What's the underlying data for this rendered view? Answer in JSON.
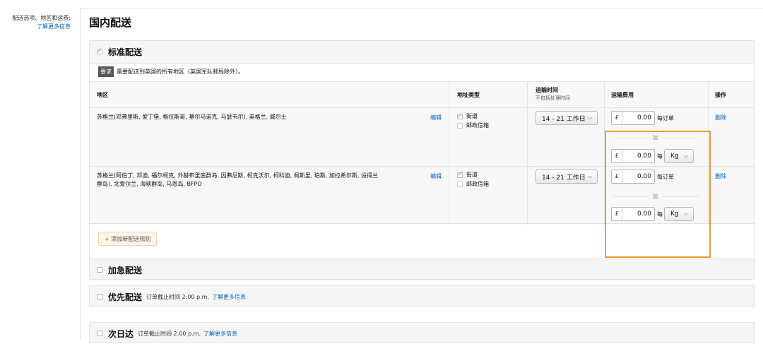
{
  "left": {
    "hint": "配送选项、地区和运费:",
    "link": "了解更多信息"
  },
  "page_title": "国内配送",
  "standard": {
    "title": "标准配送",
    "checked": true,
    "requirement_badge": "要求",
    "requirement_text": "需要配送到英国的所有地区（英国军队邮局除外）。",
    "headers": {
      "region": "地区",
      "address_type": "地址类型",
      "transit_time": "运输时间",
      "transit_sub": "不包括处理时间",
      "shipping_fee": "运输费用",
      "actions": "操作"
    },
    "rows": [
      {
        "region": "苏格兰(邓弗里斯, 爱丁堡, 格拉斯哥, 基尔马诺克, 马瑟韦尔), 英格兰, 威尔士",
        "edit": "编辑",
        "addr_street": "街道",
        "addr_po": "邮政信箱",
        "transit": "14 - 21 工作日",
        "currency": "£",
        "per_order_value": "0.00",
        "per_order_label": "每订单",
        "plus": "加",
        "per_unit_value": "0.00",
        "per_unit_label": "每",
        "unit": "Kg",
        "delete": "删除"
      },
      {
        "region": "苏格兰(阿伯丁, 邓迪, 福尔柯克, 外赫布里底群岛, 因弗尼斯, 柯克沃尔, 柯科迪, 佩斯里, 珀斯, 加拉希尔斯, 设得兰群岛), 北爱尔兰, 海峡群岛, 马恩岛, BFPO",
        "edit": "编辑",
        "addr_street": "街道",
        "addr_po": "邮政信箱",
        "transit": "14 - 21 工作日",
        "currency": "£",
        "per_order_value": "0.00",
        "per_order_label": "每订单",
        "plus": "加",
        "per_unit_value": "0.00",
        "per_unit_label": "每",
        "unit": "Kg",
        "delete": "删除"
      }
    ],
    "add_rule": "+ 添加新配送规则"
  },
  "urgent": {
    "title": "加急配送",
    "checked": false
  },
  "priority": {
    "title": "优先配送",
    "checked": false,
    "sub": "订单截止时间 2:00 p.m.",
    "link": "了解更多信息"
  },
  "nextday": {
    "title": "次日达",
    "checked": false,
    "sub": "订单截止时间 2:00 p.m.",
    "link": "了解更多信息"
  },
  "colors": {
    "link": "#0066c0",
    "highlight": "#f19a2b",
    "section_bg": "#f5f5f5"
  }
}
